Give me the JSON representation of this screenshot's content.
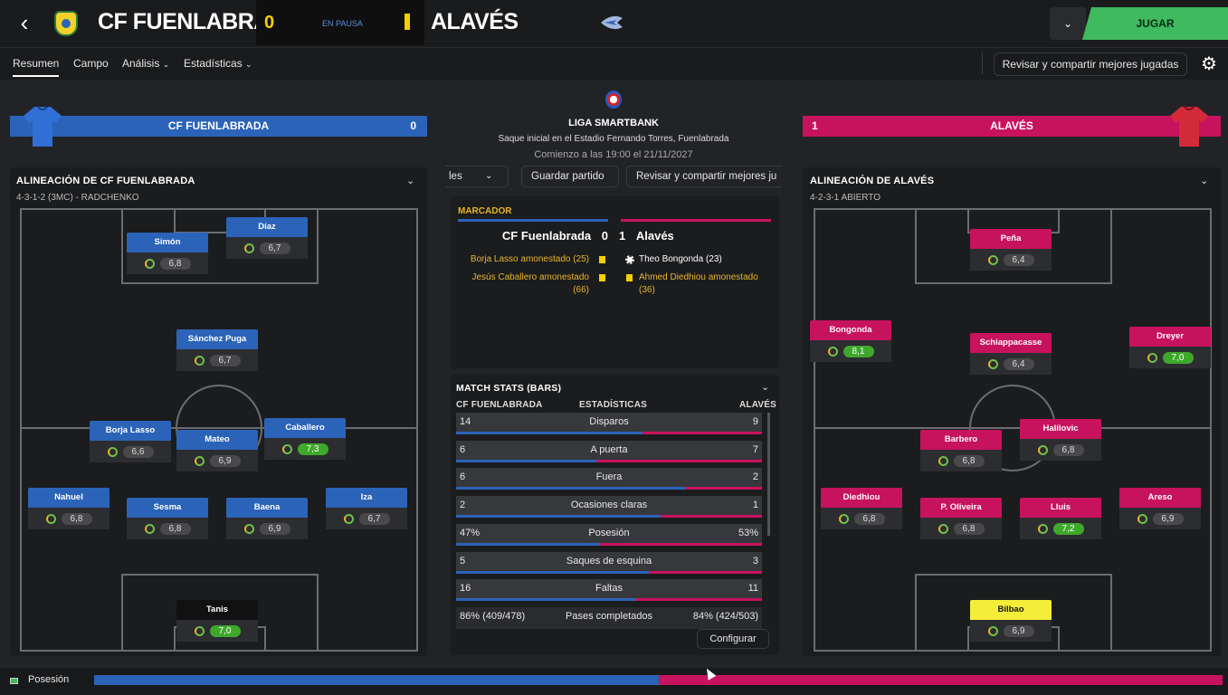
{
  "header": {
    "home_team": "CF FUENLABRADA",
    "home_score": "0",
    "status": "EN PAUSA",
    "away_team": "ALAVÉS",
    "play_button": "JUGAR",
    "dropdown_icon": "chevron-down-icon"
  },
  "nav": {
    "tabs": [
      "Resumen",
      "Campo",
      "Análisis",
      "Estadísticas"
    ],
    "share_button": "Revisar y compartir mejores jugadas"
  },
  "home": {
    "bar_name": "CF FUENLABRADA",
    "bar_score": "0",
    "color": "#2b63b8",
    "lineup_title": "ALINEACIÓN DE CF FUENLABRADA",
    "formation": "4-3-1-2 (3MC) - RADCHENKO",
    "players": [
      {
        "name": "Simón",
        "rating": "6,8"
      },
      {
        "name": "Díaz",
        "rating": "6,7"
      },
      {
        "name": "Sánchez Puga",
        "rating": "6,7"
      },
      {
        "name": "Borja Lasso",
        "rating": "6,6"
      },
      {
        "name": "Mateo",
        "rating": "6,9"
      },
      {
        "name": "Caballero",
        "rating": "7,3"
      },
      {
        "name": "Nahuel",
        "rating": "6,8"
      },
      {
        "name": "Sesma",
        "rating": "6,8"
      },
      {
        "name": "Baena",
        "rating": "6,9"
      },
      {
        "name": "Iza",
        "rating": "6,7"
      },
      {
        "name": "Tanis",
        "rating": "7,0"
      }
    ]
  },
  "away": {
    "bar_name": "ALAVÉS",
    "bar_score": "1",
    "color": "#c7125e",
    "lineup_title": "ALINEACIÓN DE ALAVÉS",
    "formation": "4-2-3-1 ABIERTO",
    "players": [
      {
        "name": "Peña",
        "rating": "6,4"
      },
      {
        "name": "Bongonda",
        "rating": "8,1"
      },
      {
        "name": "Schiappacasse",
        "rating": "6,4"
      },
      {
        "name": "Dreyer",
        "rating": "7,0"
      },
      {
        "name": "Barbero",
        "rating": "6,8"
      },
      {
        "name": "Halilovic",
        "rating": "6,8"
      },
      {
        "name": "Diedhiou",
        "rating": "6,8"
      },
      {
        "name": "P. Oliveira",
        "rating": "6,8"
      },
      {
        "name": "Lluis",
        "rating": "7,2"
      },
      {
        "name": "Areso",
        "rating": "6,9"
      },
      {
        "name": "Bilbao",
        "rating": "6,9"
      }
    ]
  },
  "match": {
    "league": "LIGA SMARTBANK",
    "venue": "Saque inicial en el Estadio Fernando Torres, Fuenlabrada",
    "kickoff": "Comienzo a las 19:00 el 21/11/2027",
    "ctrl_left": "les",
    "save_button": "Guardar partido",
    "share_button": "Revisar y compartir mejores ju"
  },
  "scoreboard": {
    "label": "MARCADOR",
    "home": "CF Fuenlabrada",
    "home_score": "0",
    "away_score": "1",
    "away": "Alavés",
    "home_events": [
      "Borja Lasso amonestado (25)",
      "Jesús Caballero amonestado (66)"
    ],
    "away_events": [
      "Theo Bongonda (23)",
      "Ahmed Diedhiou amonestado (36)"
    ]
  },
  "stats": {
    "title": "MATCH STATS (BARS)",
    "col_home": "CF FUENLABRADA",
    "col_mid": "ESTADÍSTICAS",
    "col_away": "ALAVÉS",
    "rows": [
      {
        "home": "14",
        "label": "Disparos",
        "away": "9",
        "home_share": 0.61
      },
      {
        "home": "6",
        "label": "A puerta",
        "away": "7",
        "home_share": 0.46
      },
      {
        "home": "6",
        "label": "Fuera",
        "away": "2",
        "home_share": 0.75
      },
      {
        "home": "2",
        "label": "Ocasiones claras",
        "away": "1",
        "home_share": 0.67
      },
      {
        "home": "47%",
        "label": "Posesión",
        "away": "53%",
        "home_share": 0.47
      },
      {
        "home": "5",
        "label": "Saques de esquina",
        "away": "3",
        "home_share": 0.63
      },
      {
        "home": "16",
        "label": "Faltas",
        "away": "11",
        "home_share": 0.59
      },
      {
        "home": "86% (409/478)",
        "label": "Pases completados",
        "away": "84% (424/503)",
        "home_share": 0.5
      }
    ],
    "config_button": "Configurar"
  },
  "footer": {
    "label": "Posesión",
    "home_share": 0.5
  }
}
